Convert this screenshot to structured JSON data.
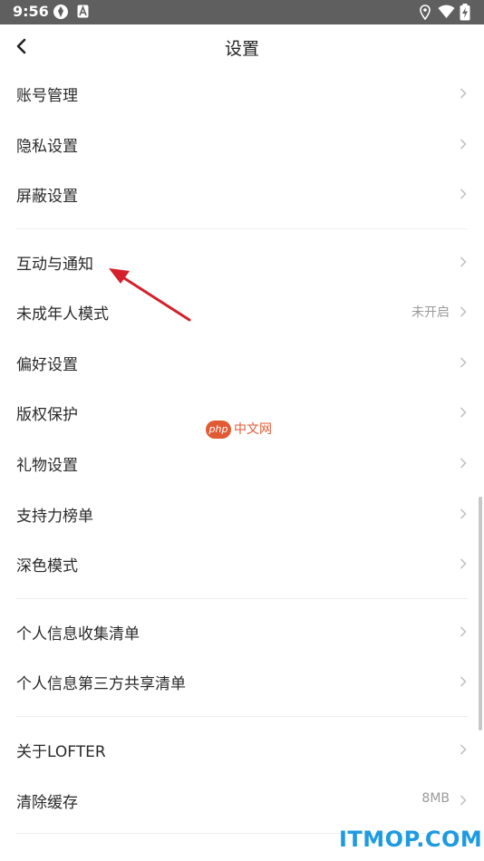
{
  "status_bar": {
    "time": "9:56"
  },
  "header": {
    "title": "设置"
  },
  "groups": [
    {
      "items": [
        {
          "label": "账号管理",
          "value": ""
        },
        {
          "label": "隐私设置",
          "value": ""
        },
        {
          "label": "屏蔽设置",
          "value": ""
        }
      ]
    },
    {
      "items": [
        {
          "label": "互动与通知",
          "value": ""
        },
        {
          "label": "未成年人模式",
          "value": "未开启"
        },
        {
          "label": "偏好设置",
          "value": ""
        },
        {
          "label": "版权保护",
          "value": ""
        },
        {
          "label": "礼物设置",
          "value": ""
        },
        {
          "label": "支持力榜单",
          "value": ""
        },
        {
          "label": "深色模式",
          "value": ""
        }
      ]
    },
    {
      "items": [
        {
          "label": "个人信息收集清单",
          "value": ""
        },
        {
          "label": "个人信息第三方共享清单",
          "value": ""
        }
      ]
    },
    {
      "items": [
        {
          "label": "关于LOFTER",
          "value": ""
        },
        {
          "label": "清除缓存",
          "value": "8MB"
        }
      ]
    }
  ],
  "watermarks": {
    "php_badge": "php",
    "php_text": "中文网",
    "itmop": "ITMOP.COM"
  },
  "colors": {
    "arrow": "#d4202a",
    "itmop": "#1e9be0",
    "php": "#e05a34"
  }
}
